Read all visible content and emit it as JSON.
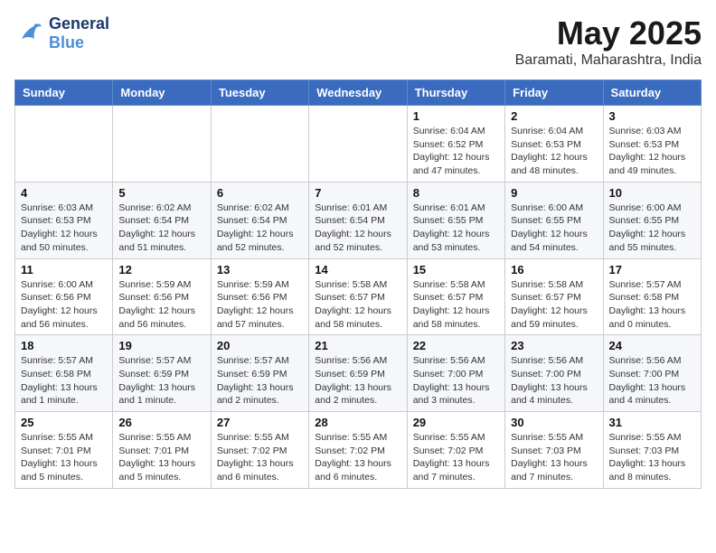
{
  "header": {
    "logo_line1": "General",
    "logo_line2": "Blue",
    "month_year": "May 2025",
    "location": "Baramati, Maharashtra, India"
  },
  "weekdays": [
    "Sunday",
    "Monday",
    "Tuesday",
    "Wednesday",
    "Thursday",
    "Friday",
    "Saturday"
  ],
  "weeks": [
    [
      {
        "day": "",
        "info": ""
      },
      {
        "day": "",
        "info": ""
      },
      {
        "day": "",
        "info": ""
      },
      {
        "day": "",
        "info": ""
      },
      {
        "day": "1",
        "info": "Sunrise: 6:04 AM\nSunset: 6:52 PM\nDaylight: 12 hours\nand 47 minutes."
      },
      {
        "day": "2",
        "info": "Sunrise: 6:04 AM\nSunset: 6:53 PM\nDaylight: 12 hours\nand 48 minutes."
      },
      {
        "day": "3",
        "info": "Sunrise: 6:03 AM\nSunset: 6:53 PM\nDaylight: 12 hours\nand 49 minutes."
      }
    ],
    [
      {
        "day": "4",
        "info": "Sunrise: 6:03 AM\nSunset: 6:53 PM\nDaylight: 12 hours\nand 50 minutes."
      },
      {
        "day": "5",
        "info": "Sunrise: 6:02 AM\nSunset: 6:54 PM\nDaylight: 12 hours\nand 51 minutes."
      },
      {
        "day": "6",
        "info": "Sunrise: 6:02 AM\nSunset: 6:54 PM\nDaylight: 12 hours\nand 52 minutes."
      },
      {
        "day": "7",
        "info": "Sunrise: 6:01 AM\nSunset: 6:54 PM\nDaylight: 12 hours\nand 52 minutes."
      },
      {
        "day": "8",
        "info": "Sunrise: 6:01 AM\nSunset: 6:55 PM\nDaylight: 12 hours\nand 53 minutes."
      },
      {
        "day": "9",
        "info": "Sunrise: 6:00 AM\nSunset: 6:55 PM\nDaylight: 12 hours\nand 54 minutes."
      },
      {
        "day": "10",
        "info": "Sunrise: 6:00 AM\nSunset: 6:55 PM\nDaylight: 12 hours\nand 55 minutes."
      }
    ],
    [
      {
        "day": "11",
        "info": "Sunrise: 6:00 AM\nSunset: 6:56 PM\nDaylight: 12 hours\nand 56 minutes."
      },
      {
        "day": "12",
        "info": "Sunrise: 5:59 AM\nSunset: 6:56 PM\nDaylight: 12 hours\nand 56 minutes."
      },
      {
        "day": "13",
        "info": "Sunrise: 5:59 AM\nSunset: 6:56 PM\nDaylight: 12 hours\nand 57 minutes."
      },
      {
        "day": "14",
        "info": "Sunrise: 5:58 AM\nSunset: 6:57 PM\nDaylight: 12 hours\nand 58 minutes."
      },
      {
        "day": "15",
        "info": "Sunrise: 5:58 AM\nSunset: 6:57 PM\nDaylight: 12 hours\nand 58 minutes."
      },
      {
        "day": "16",
        "info": "Sunrise: 5:58 AM\nSunset: 6:57 PM\nDaylight: 12 hours\nand 59 minutes."
      },
      {
        "day": "17",
        "info": "Sunrise: 5:57 AM\nSunset: 6:58 PM\nDaylight: 13 hours\nand 0 minutes."
      }
    ],
    [
      {
        "day": "18",
        "info": "Sunrise: 5:57 AM\nSunset: 6:58 PM\nDaylight: 13 hours\nand 1 minute."
      },
      {
        "day": "19",
        "info": "Sunrise: 5:57 AM\nSunset: 6:59 PM\nDaylight: 13 hours\nand 1 minute."
      },
      {
        "day": "20",
        "info": "Sunrise: 5:57 AM\nSunset: 6:59 PM\nDaylight: 13 hours\nand 2 minutes."
      },
      {
        "day": "21",
        "info": "Sunrise: 5:56 AM\nSunset: 6:59 PM\nDaylight: 13 hours\nand 2 minutes."
      },
      {
        "day": "22",
        "info": "Sunrise: 5:56 AM\nSunset: 7:00 PM\nDaylight: 13 hours\nand 3 minutes."
      },
      {
        "day": "23",
        "info": "Sunrise: 5:56 AM\nSunset: 7:00 PM\nDaylight: 13 hours\nand 4 minutes."
      },
      {
        "day": "24",
        "info": "Sunrise: 5:56 AM\nSunset: 7:00 PM\nDaylight: 13 hours\nand 4 minutes."
      }
    ],
    [
      {
        "day": "25",
        "info": "Sunrise: 5:55 AM\nSunset: 7:01 PM\nDaylight: 13 hours\nand 5 minutes."
      },
      {
        "day": "26",
        "info": "Sunrise: 5:55 AM\nSunset: 7:01 PM\nDaylight: 13 hours\nand 5 minutes."
      },
      {
        "day": "27",
        "info": "Sunrise: 5:55 AM\nSunset: 7:02 PM\nDaylight: 13 hours\nand 6 minutes."
      },
      {
        "day": "28",
        "info": "Sunrise: 5:55 AM\nSunset: 7:02 PM\nDaylight: 13 hours\nand 6 minutes."
      },
      {
        "day": "29",
        "info": "Sunrise: 5:55 AM\nSunset: 7:02 PM\nDaylight: 13 hours\nand 7 minutes."
      },
      {
        "day": "30",
        "info": "Sunrise: 5:55 AM\nSunset: 7:03 PM\nDaylight: 13 hours\nand 7 minutes."
      },
      {
        "day": "31",
        "info": "Sunrise: 5:55 AM\nSunset: 7:03 PM\nDaylight: 13 hours\nand 8 minutes."
      }
    ]
  ]
}
